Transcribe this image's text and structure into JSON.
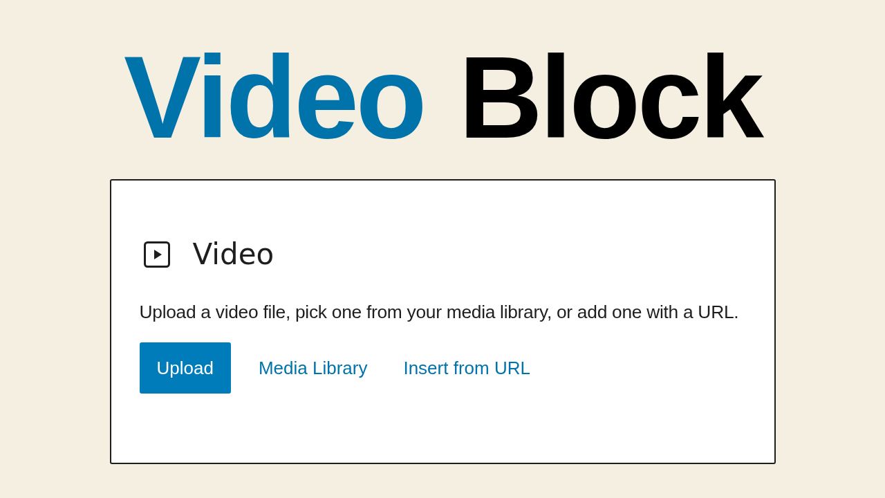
{
  "headline": [
    {
      "text": "Video",
      "color": "#0073aa"
    },
    {
      "text": "Block",
      "color": "#000000"
    }
  ],
  "block": {
    "title": "Video",
    "description": "Upload a video file, pick one from your media library, or add one with a URL.",
    "buttons": [
      {
        "label": "Upload",
        "kind": "primary"
      },
      {
        "label": "Media Library",
        "kind": "link"
      },
      {
        "label": "Insert from URL",
        "kind": "link"
      }
    ]
  }
}
